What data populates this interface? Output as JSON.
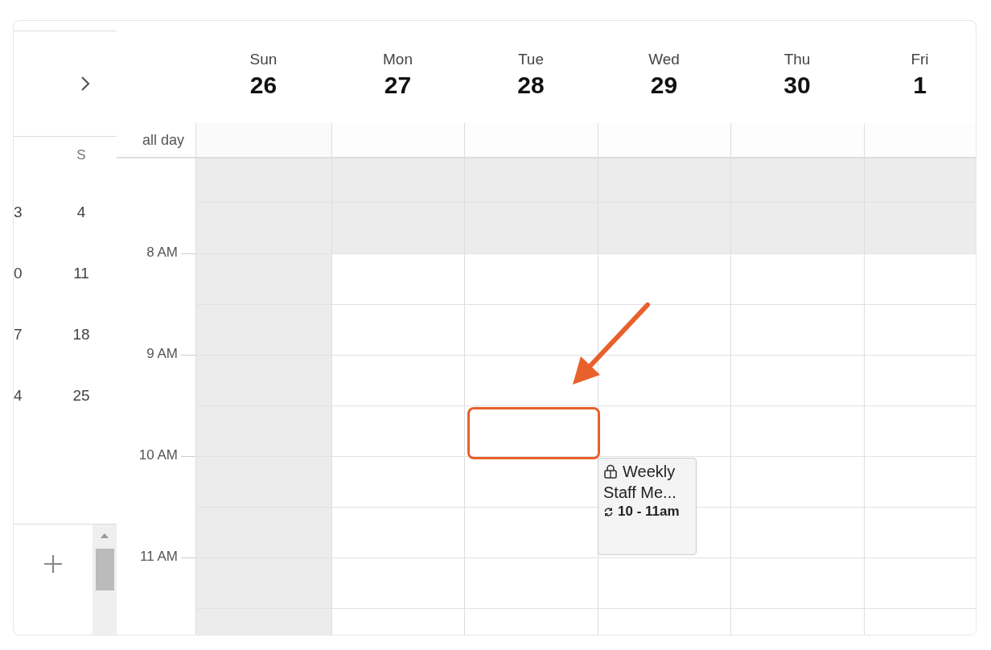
{
  "mini_calendar": {
    "weekdays": [
      "S"
    ],
    "weeks": [
      [
        "3",
        "4"
      ],
      [
        "0",
        "11"
      ],
      [
        "7",
        "18"
      ],
      [
        "4",
        "25"
      ]
    ]
  },
  "days": [
    {
      "name": "Sun",
      "date": "26",
      "weekend": true
    },
    {
      "name": "Mon",
      "date": "27",
      "weekend": false
    },
    {
      "name": "Tue",
      "date": "28",
      "weekend": false
    },
    {
      "name": "Wed",
      "date": "29",
      "weekend": false,
      "events": [
        {
          "title": "Weekly Staff Me...",
          "time": "10 - 11am",
          "locked": true,
          "recurring": true
        }
      ]
    },
    {
      "name": "Thu",
      "date": "30",
      "weekend": false
    },
    {
      "name": "Fri",
      "date": "1",
      "weekend": false
    }
  ],
  "all_day_label": "all day",
  "slots": [
    {
      "business": false
    },
    {
      "business": false
    },
    {
      "label": "8 AM",
      "business": true
    },
    {
      "business": true
    },
    {
      "label": "9 AM",
      "business": true
    },
    {
      "business": true
    },
    {
      "label": "10 AM",
      "business": true
    },
    {
      "business": true
    },
    {
      "label": "11 AM",
      "business": true
    },
    {
      "business": true
    }
  ]
}
